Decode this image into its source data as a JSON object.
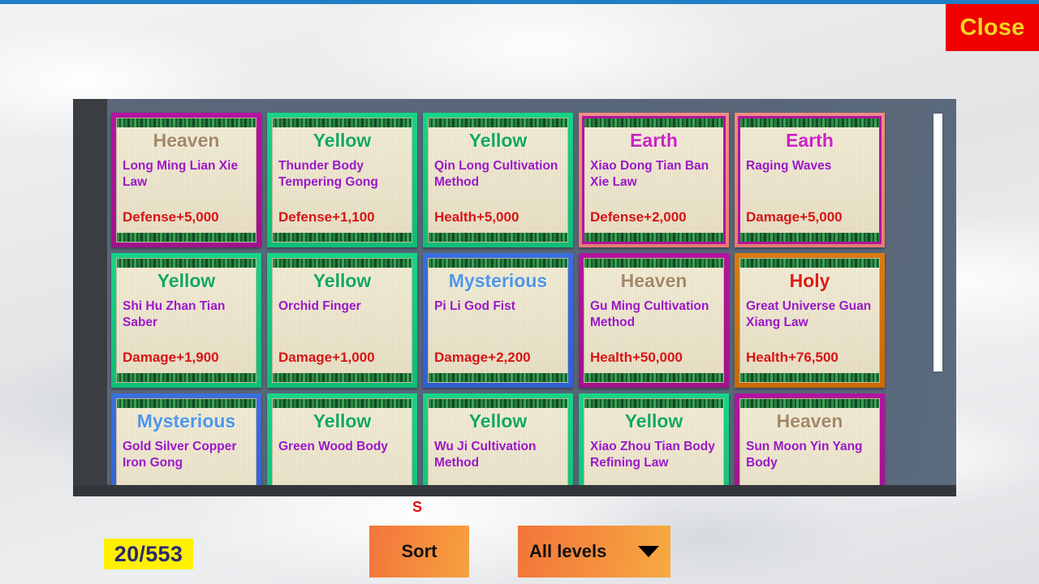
{
  "window": {
    "top_bar_color": "#1f7fc4",
    "background_color": "#e7e8ea"
  },
  "close_button": {
    "label": "Close",
    "bg": "#f20000",
    "fg": "#ffd320"
  },
  "panel": {
    "bg": "#5a6779"
  },
  "scrollbar": {
    "thumb_color": "#ffffff"
  },
  "rarity_colors": {
    "Heaven": "#b3159e",
    "Yellow": "#17d487",
    "Earth": "#f08d85",
    "Mysterious": "#3a6fe0",
    "Holy": "#d97b12"
  },
  "cards": [
    {
      "rarity": "Heaven",
      "name": "Long Ming Lian Xie Law",
      "stat": "Defense+5,000"
    },
    {
      "rarity": "Yellow",
      "name": "Thunder Body Tempering Gong",
      "stat": "Defense+1,100"
    },
    {
      "rarity": "Yellow",
      "name": "Qin Long Cultivation Method",
      "stat": "Health+5,000"
    },
    {
      "rarity": "Earth",
      "name": "Xiao Dong Tian Ban Xie Law",
      "stat": "Defense+2,000"
    },
    {
      "rarity": "Earth",
      "name": "Raging Waves",
      "stat": "Damage+5,000"
    },
    {
      "rarity": "Yellow",
      "name": "Shi Hu Zhan Tian Saber",
      "stat": "Damage+1,900"
    },
    {
      "rarity": "Yellow",
      "name": "Orchid Finger",
      "stat": "Damage+1,000"
    },
    {
      "rarity": "Mysterious",
      "name": "Pi Li God Fist",
      "stat": "Damage+2,200"
    },
    {
      "rarity": "Heaven",
      "name": "Gu Ming Cultivation Method",
      "stat": "Health+50,000"
    },
    {
      "rarity": "Holy",
      "name": "Great Universe Guan Xiang Law",
      "stat": "Health+76,500"
    },
    {
      "rarity": "Mysterious",
      "name": "Gold Silver Copper Iron Gong",
      "stat": ""
    },
    {
      "rarity": "Yellow",
      "name": "Green Wood Body",
      "stat": ""
    },
    {
      "rarity": "Yellow",
      "name": "Wu Ji Cultivation Method",
      "stat": ""
    },
    {
      "rarity": "Yellow",
      "name": "Xiao Zhou Tian Body Refining Law",
      "stat": ""
    },
    {
      "rarity": "Heaven",
      "name": "Sun Moon Yin Yang Body",
      "stat": ""
    }
  ],
  "footer": {
    "count": "20/553",
    "sort_flag": "S",
    "sort_label": "Sort",
    "level_filter": "All levels",
    "caret": "chevron-down-icon"
  }
}
